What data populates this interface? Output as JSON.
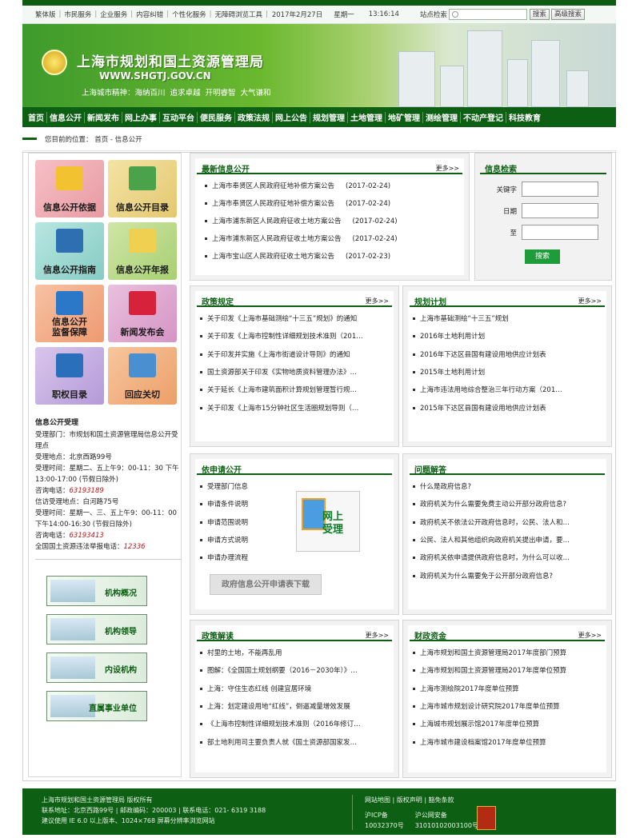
{
  "topbar": {
    "links": [
      "繁体版",
      "市民服务",
      "企业服务",
      "内容纠错",
      "个性化服务",
      "无障碍浏览工具"
    ],
    "date": "2017年2月27日",
    "weekday": "星期一",
    "time": "13:16:14",
    "search_label": "站点检索",
    "search_btn": "搜索",
    "adv_btn": "高级搜索"
  },
  "banner": {
    "title": "上海市规划和国土资源管理局",
    "site": "WWW.SHGTJ.GOV.CN",
    "spirit": "上海城市精神：海纳百川  追求卓越  开明睿智  大气谦和"
  },
  "nav": [
    "首页",
    "信息公开",
    "新闻发布",
    "网上办事",
    "互动平台",
    "便民服务",
    "政策法规",
    "网上公告",
    "规划管理",
    "土地管理",
    "地矿管理",
    "测绘管理",
    "不动产登记",
    "科技教育"
  ],
  "breadcrumb": "您目前的位置：  首页 - 信息公开",
  "tiles": [
    "信息公开依据",
    "信息公开目录",
    "信息公开指南",
    "信息公开年报",
    "信息公开\n监督保障",
    "新闻发布会",
    "职权目录",
    "回应关切"
  ],
  "service": {
    "heading": "信息公开受理",
    "lines": [
      {
        "t": "受理部门：市规划和国土资源管理局信息公开受理点"
      },
      {
        "t": "受理地点：北京西路99号"
      },
      {
        "t": "受理时间：星期二、五上午9：00-11：30 下午13:00-17:00 (节假日除外)"
      },
      {
        "t": "咨询电话：",
        "r": "63193189"
      },
      {
        "t": "信访受理地点：白河路75号"
      },
      {
        "t": "受理时间：星期一、三、五上午9：00-11：00 下午14:00-16:30 (节假日除外)"
      },
      {
        "t": "咨询电话：",
        "r": "63193413"
      },
      {
        "t": "全国国土资源违法举报电话：",
        "r": "12336"
      }
    ]
  },
  "left_buttons": [
    "机构概况",
    "机构领导",
    "内设机构",
    "直属事业单位"
  ],
  "more": "更多>>",
  "latest": {
    "title": "最新信息公开",
    "items": [
      {
        "t": "上海市奉贤区人民政府征地补偿方案公告",
        "d": "(2017-02-24)"
      },
      {
        "t": "上海市奉贤区人民政府征地补偿方案公告",
        "d": "(2017-02-24)"
      },
      {
        "t": "上海市浦东新区人民政府征收土地方案公告",
        "d": "(2017-02-24)"
      },
      {
        "t": "上海市浦东新区人民政府征收土地方案公告",
        "d": "(2017-02-24)"
      },
      {
        "t": "上海市宝山区人民政府征收土地方案公告",
        "d": "(2017-02-23)"
      }
    ]
  },
  "search_panel": {
    "title": "信息检索",
    "keyword": "关键字",
    "date": "日期",
    "to": "至",
    "button": "搜索"
  },
  "policy": {
    "title": "政策规定",
    "items": [
      "关于印发《上海市基础测绘“十三五”规划》的通知",
      "关于印发《上海市控制性详细规划技术准则（201…",
      "关于印发并实施《上海市街道设计导则》的通知",
      "国土资源部关于印发《实物地质资料管理办法》…",
      "关于延长《上海市建筑面积计算规划管理暂行规…",
      "关于印发《上海市15分钟社区生活圈规划导则（…"
    ]
  },
  "plan": {
    "title": "规划计划",
    "items": [
      "上海市基础测绘“十三五”规划",
      "2016年土地利用计划",
      "2016年下达区县国有建设用地供应计划表",
      "2015年土地利用计划",
      "上海市违法用地综合整治三年行动方案（201…",
      "2015年下达区县国有建设用地供应计划表"
    ]
  },
  "apply": {
    "title": "依申请公开",
    "items": [
      "受理部门信息",
      "申请条件说明",
      "申请范围说明",
      "申请方式说明",
      "申请办理流程"
    ],
    "online": "网上\n受理",
    "download": "政府信息公开申请表下载"
  },
  "qa": {
    "title": "问题解答",
    "items": [
      "什么是政府信息?",
      "政府机关为什么需要免费主动公开部分政府信息?",
      "政府机关不依法公开政府信息时，公民、法人和…",
      "公民、法人和其他组织向政府机关提出申请，要…",
      "政府机关依申请提供政府信息时，为什么可以收…",
      "政府机关为什么需要免于公开部分政府信息?"
    ]
  },
  "interp": {
    "title": "政策解读",
    "items": [
      "村里的土地，不能再乱用",
      "图解：《全国国土规划纲要（2016－2030年）》…",
      "上海：守住生态红线 创建宜居环境",
      "上海：划定建设用地“红线”，倒逼减量增效发展",
      "《上海市控制性详细规划技术准则（2016年修订…",
      "部土地利用司主要负责人就《国土资源部国家发…"
    ]
  },
  "finance": {
    "title": "财政资金",
    "items": [
      "上海市规划和国土资源管理局2017年度部门预算",
      "上海市规划和国土资源管理局2017年度单位预算",
      "上海市测绘院2017年度单位预算",
      "上海市城市规划设计研究院2017年度单位预算",
      "上海城市规划展示馆2017年度单位预算",
      "上海市城市建设档案馆2017年度单位预算"
    ]
  },
  "footer": {
    "l1": "上海市规划和国土资源管理局  版权所有",
    "l2": "联系地址：北京西路99号  |  邮政编码：200003  |  联系电话：021- 6319 3188",
    "l3": "建议使用 IE 6.0 以上版本、1024×768  屏幕分辨率浏览网站",
    "r1": "网站地图  |  版权声明  |  豁免条款",
    "icp": "沪ICP备",
    "icp_no": "10032370号",
    "police": "沪公网安备",
    "police_no": "31010102003100号"
  }
}
